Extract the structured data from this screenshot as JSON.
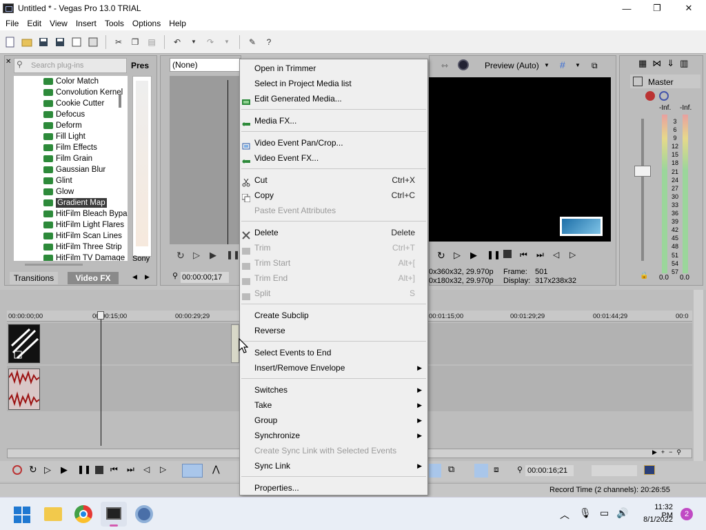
{
  "window": {
    "title": "Untitled * - Vegas Pro 13.0 TRIAL",
    "minimize": "—",
    "maximize": "❐",
    "close": "✕"
  },
  "menubar": [
    "File",
    "Edit",
    "View",
    "Insert",
    "Tools",
    "Options",
    "Help"
  ],
  "plugins": {
    "search_placeholder": "Search plug-ins",
    "items": [
      "Color Match",
      "Convolution Kernel",
      "Cookie Cutter",
      "Defocus",
      "Deform",
      "Fill Light",
      "Film Effects",
      "Film Grain",
      "Gaussian Blur",
      "Glint",
      "Glow",
      "Gradient Map",
      "HitFilm Bleach Bypass",
      "HitFilm Light Flares",
      "HitFilm Scan Lines",
      "HitFilm Three Strip",
      "HitFilm TV Damage"
    ],
    "selected": "Gradient Map",
    "presets_header": "Pres",
    "presets_footer": "Sony",
    "tabs": [
      "Transitions",
      "Video FX"
    ]
  },
  "trimmer": {
    "dropdown": "(None)",
    "timecode": "00:00:00;17"
  },
  "preview": {
    "mode": "Preview (Auto)",
    "info1": "0x360x32, 29.970p",
    "info2": "0x180x32, 29.970p",
    "frame_label": "Frame:",
    "frame_value": "501",
    "display_label": "Display:",
    "display_value": "317x238x32"
  },
  "master": {
    "label": "Master",
    "inf_left": "-Inf.",
    "inf_right": "-Inf.",
    "scale": [
      "3",
      "6",
      "9",
      "12",
      "15",
      "18",
      "21",
      "24",
      "27",
      "30",
      "33",
      "36",
      "39",
      "42",
      "45",
      "48",
      "51",
      "54",
      "57"
    ],
    "value_left": "0.0",
    "value_right": "0.0"
  },
  "ruler": [
    "00:00:00;00",
    "00:00:15;00",
    "00:00:29;29",
    "00:01:15;00",
    "00:01:29;29",
    "00:01:44;29",
    "00:0"
  ],
  "transport": {
    "timecode": "00:00:16;21"
  },
  "status": {
    "record_time": "Record Time (2 channels): 20:26:55"
  },
  "context_menu": [
    {
      "label": "Open in Trimmer"
    },
    {
      "label": "Select in Project Media list"
    },
    {
      "label": "Edit Generated Media...",
      "icon": "generated-media-icon"
    },
    {
      "sep": true
    },
    {
      "label": "Media FX...",
      "icon": "fx-plug-icon"
    },
    {
      "sep": true
    },
    {
      "label": "Video Event Pan/Crop...",
      "icon": "pan-crop-icon"
    },
    {
      "label": "Video Event FX...",
      "icon": "fx-plug-icon"
    },
    {
      "sep": true
    },
    {
      "label": "Cut",
      "shortcut": "Ctrl+X",
      "icon": "scissors-icon"
    },
    {
      "label": "Copy",
      "shortcut": "Ctrl+C",
      "icon": "copy-icon"
    },
    {
      "label": "Paste Event Attributes",
      "disabled": true
    },
    {
      "sep": true
    },
    {
      "label": "Delete",
      "shortcut": "Delete",
      "icon": "delete-icon"
    },
    {
      "label": "Trim",
      "shortcut": "Ctrl+T",
      "disabled": true,
      "icon": "trim-icon"
    },
    {
      "label": "Trim Start",
      "shortcut": "Alt+[",
      "disabled": true,
      "icon": "trim-start-icon"
    },
    {
      "label": "Trim End",
      "shortcut": "Alt+]",
      "disabled": true,
      "icon": "trim-end-icon"
    },
    {
      "label": "Split",
      "shortcut": "S",
      "disabled": true,
      "icon": "split-icon"
    },
    {
      "sep": true
    },
    {
      "label": "Create Subclip"
    },
    {
      "label": "Reverse"
    },
    {
      "sep": true
    },
    {
      "label": "Select Events to End"
    },
    {
      "label": "Insert/Remove Envelope",
      "submenu": true
    },
    {
      "sep": true
    },
    {
      "label": "Switches",
      "submenu": true
    },
    {
      "label": "Take",
      "submenu": true
    },
    {
      "label": "Group",
      "submenu": true
    },
    {
      "label": "Synchronize",
      "submenu": true
    },
    {
      "label": "Create Sync Link with Selected Events",
      "disabled": true
    },
    {
      "label": "Sync Link",
      "submenu": true
    },
    {
      "sep": true
    },
    {
      "label": "Properties..."
    }
  ],
  "taskbar": {
    "time": "11:32 PM",
    "date": "8/1/2022",
    "notifications": "2"
  }
}
